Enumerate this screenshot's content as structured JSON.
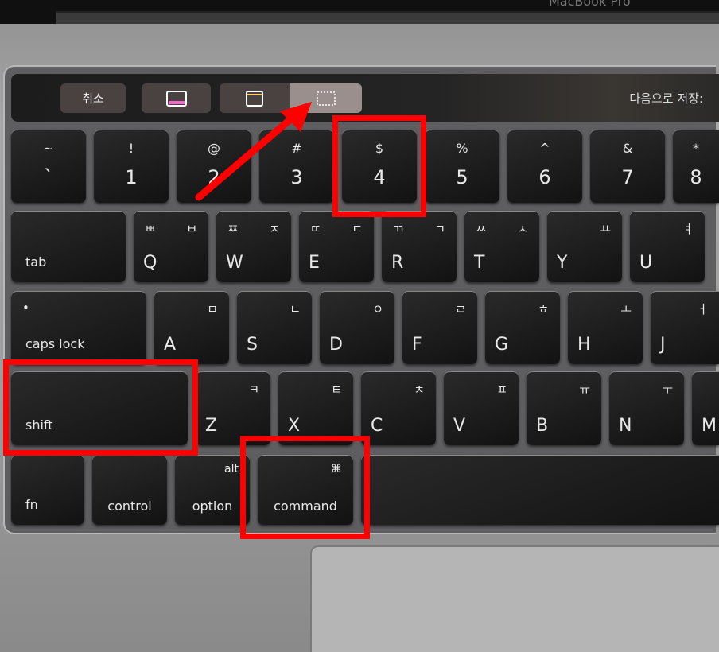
{
  "bezel_text": "MacBook Pro",
  "touchbar": {
    "cancel": "취소",
    "buttons": [
      {
        "icon": "capture-entire-screen-icon"
      },
      {
        "icon": "capture-window-icon"
      },
      {
        "icon": "capture-selection-icon",
        "selected": true
      }
    ],
    "save_to": "다음으로 저장:"
  },
  "rows": [
    [
      {
        "top": "~",
        "main": "`"
      },
      {
        "top": "!",
        "main": "1"
      },
      {
        "top": "@",
        "main": "2"
      },
      {
        "top": "#",
        "main": "3"
      },
      {
        "top": "$",
        "main": "4"
      },
      {
        "top": "%",
        "main": "5"
      },
      {
        "top": "^",
        "main": "6"
      },
      {
        "top": "&",
        "main": "7"
      },
      {
        "top": "*",
        "main": "8"
      }
    ],
    [
      {
        "mod": "tab"
      },
      {
        "hl": "ㅃ",
        "hr": "ㅂ",
        "letter": "Q"
      },
      {
        "hl": "ㅉ",
        "hr": "ㅈ",
        "letter": "W"
      },
      {
        "hl": "ㄸ",
        "hr": "ㄷ",
        "letter": "E"
      },
      {
        "hl": "ㄲ",
        "hr": "ㄱ",
        "letter": "R"
      },
      {
        "hl": "ㅆ",
        "hr": "ㅅ",
        "letter": "T"
      },
      {
        "hr": "ㅛ",
        "letter": "Y"
      },
      {
        "hr": "ㅕ",
        "letter": "U"
      }
    ],
    [
      {
        "dot": "•",
        "mod": "caps lock"
      },
      {
        "hr": "ㅁ",
        "letter": "A"
      },
      {
        "hr": "ㄴ",
        "letter": "S"
      },
      {
        "hr": "ㅇ",
        "letter": "D"
      },
      {
        "hr": "ㄹ",
        "letter": "F"
      },
      {
        "hr": "ㅎ",
        "letter": "G"
      },
      {
        "hr": "ㅗ",
        "letter": "H"
      },
      {
        "hr": "ㅓ",
        "letter": "J"
      }
    ],
    [
      {
        "mod": "shift"
      },
      {
        "hr": "ㅋ",
        "letter": "Z"
      },
      {
        "hr": "ㅌ",
        "letter": "X"
      },
      {
        "hr": "ㅊ",
        "letter": "C"
      },
      {
        "hr": "ㅍ",
        "letter": "V"
      },
      {
        "hr": "ㅠ",
        "letter": "B"
      },
      {
        "hr": "ㅜ",
        "letter": "N"
      },
      {
        "letter": "M"
      }
    ],
    [
      {
        "mod": "fn"
      },
      {
        "modc": "control"
      },
      {
        "modtop": "alt",
        "modc": "option"
      },
      {
        "modtop": "⌘",
        "modc": "command"
      },
      {}
    ]
  ],
  "annotations": {
    "color": "#ff0000",
    "highlighted_keys": [
      "4",
      "shift",
      "command"
    ],
    "arrow_target": "capture-selection-icon"
  }
}
